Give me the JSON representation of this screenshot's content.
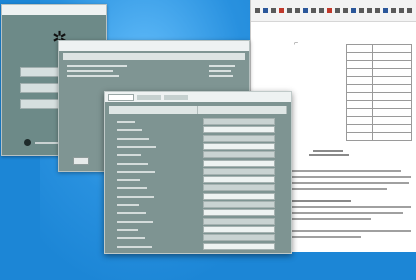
{
  "front_dialog": {
    "rows": 16,
    "tabs": 3
  },
  "colors": {
    "desktop": "#1c86d6",
    "dialog_body": "#7e9492",
    "document": "#ffffff"
  }
}
